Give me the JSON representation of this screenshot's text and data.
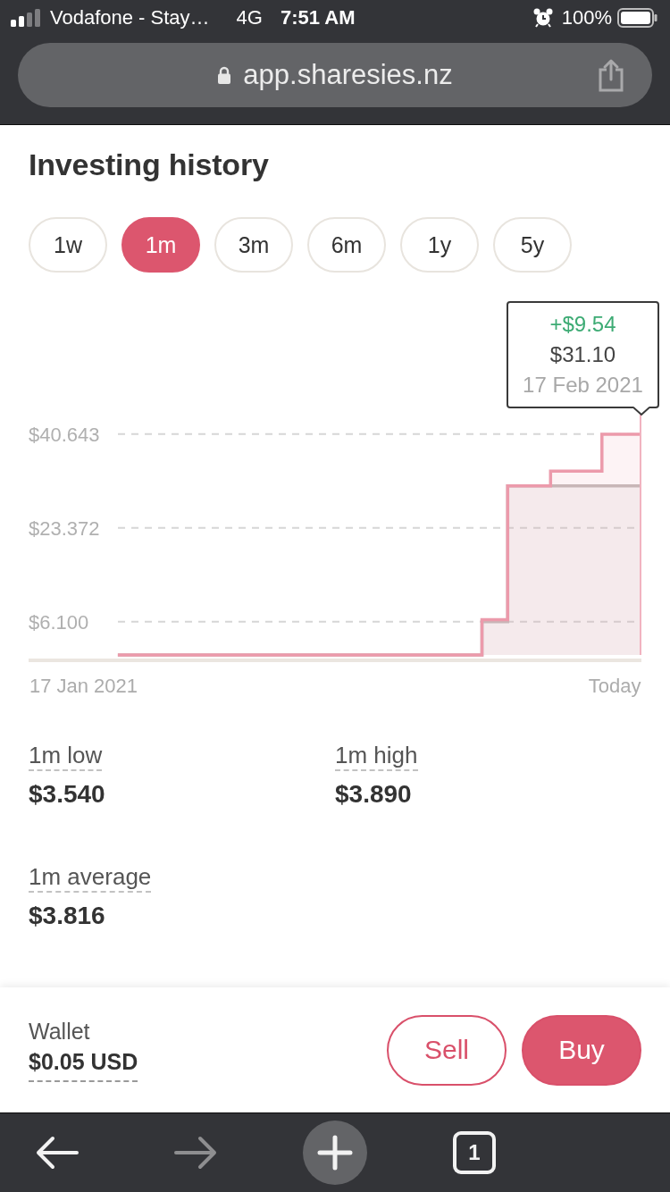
{
  "status_bar": {
    "carrier": "Vodafone - Stay…",
    "network": "4G",
    "time": "7:51 AM",
    "battery": "100%"
  },
  "address_bar": {
    "url": "app.sharesies.nz"
  },
  "title": "Investing history",
  "range_tabs": [
    {
      "label": "1w",
      "selected": false
    },
    {
      "label": "1m",
      "selected": true
    },
    {
      "label": "3m",
      "selected": false
    },
    {
      "label": "6m",
      "selected": false
    },
    {
      "label": "1y",
      "selected": false
    },
    {
      "label": "5y",
      "selected": false
    }
  ],
  "chart": {
    "tooltip": {
      "change": "+$9.54",
      "value": "$31.10",
      "date": "17 Feb 2021"
    },
    "chart_data": {
      "type": "area",
      "grid": true,
      "categories": [
        "17 Jan 2021",
        null,
        null,
        null,
        null,
        null,
        null,
        null,
        null,
        null,
        null,
        null,
        null,
        null,
        null,
        null,
        null,
        null,
        null,
        null,
        null,
        null,
        null,
        null,
        null,
        null,
        null,
        null,
        null,
        null,
        null,
        null,
        null,
        null,
        null,
        null,
        null,
        null,
        null,
        null,
        null,
        null,
        null,
        null,
        null,
        null,
        null,
        null,
        null,
        null,
        null,
        null,
        null,
        null,
        null,
        null,
        null,
        null,
        null,
        null,
        null,
        null,
        "Today",
        null,
        null,
        null
      ],
      "series": [
        {
          "color": "#ec9aab",
          "values": [
            null,
            null,
            null,
            null,
            0,
            0,
            0,
            0,
            0,
            0,
            0,
            0,
            0,
            0,
            0,
            0,
            0,
            0,
            0,
            0,
            0,
            0,
            0,
            0,
            0,
            0,
            0,
            0,
            0,
            0,
            0,
            0,
            0,
            0,
            0,
            0,
            0,
            0,
            0,
            0,
            0,
            0,
            0,
            0,
            0,
            0,
            0,
            6.5,
            6.5,
            6.5,
            31.1,
            31.1,
            31.1,
            31.1,
            31.1,
            33.8,
            33.8,
            33.8,
            33.8,
            33.8,
            33.8,
            40.6,
            40.6,
            40.6,
            40.6,
            40.6
          ]
        },
        {
          "color": "#c8b6b7",
          "values": [
            null,
            null,
            null,
            null,
            0,
            0,
            0,
            0,
            0,
            0,
            0,
            0,
            0,
            0,
            0,
            0,
            0,
            0,
            0,
            0,
            0,
            0,
            0,
            0,
            0,
            0,
            0,
            0,
            0,
            0,
            0,
            0,
            0,
            0,
            0,
            0,
            0,
            0,
            0,
            0,
            0,
            0,
            0,
            0,
            0,
            0,
            0,
            6.1,
            6.1,
            6.1,
            31.1,
            31.1,
            31.1,
            31.1,
            31.1,
            31.1,
            31.1,
            31.1,
            31.1,
            31.1,
            31.1,
            31.1,
            31.1,
            31.1,
            31.1,
            31.1
          ]
        }
      ],
      "ylim": [
        -1,
        40.643
      ],
      "yticks": [
        {
          "value": 6.1,
          "label": "$6.100"
        },
        {
          "value": 23.372,
          "label": "$23.372"
        },
        {
          "value": 40.643,
          "label": "$40.643"
        }
      ]
    }
  },
  "stats": [
    {
      "label": "1m low",
      "value": "$3.540"
    },
    {
      "label": "1m high",
      "value": "$3.890"
    },
    {
      "label": "1m average",
      "value": "$3.816"
    }
  ],
  "wallet": {
    "label": "Wallet",
    "balance": "$0.05 USD"
  },
  "actions": [
    {
      "label": "Sell",
      "kind": "outline"
    },
    {
      "label": "Buy",
      "kind": "filled"
    }
  ],
  "browser_toolbar": [
    {
      "kind": "back",
      "disabled": false
    },
    {
      "kind": "forward",
      "disabled": true
    },
    {
      "kind": "new_tab",
      "disabled": false
    },
    {
      "kind": "tab_switcher",
      "label": "1",
      "disabled": false
    }
  ]
}
